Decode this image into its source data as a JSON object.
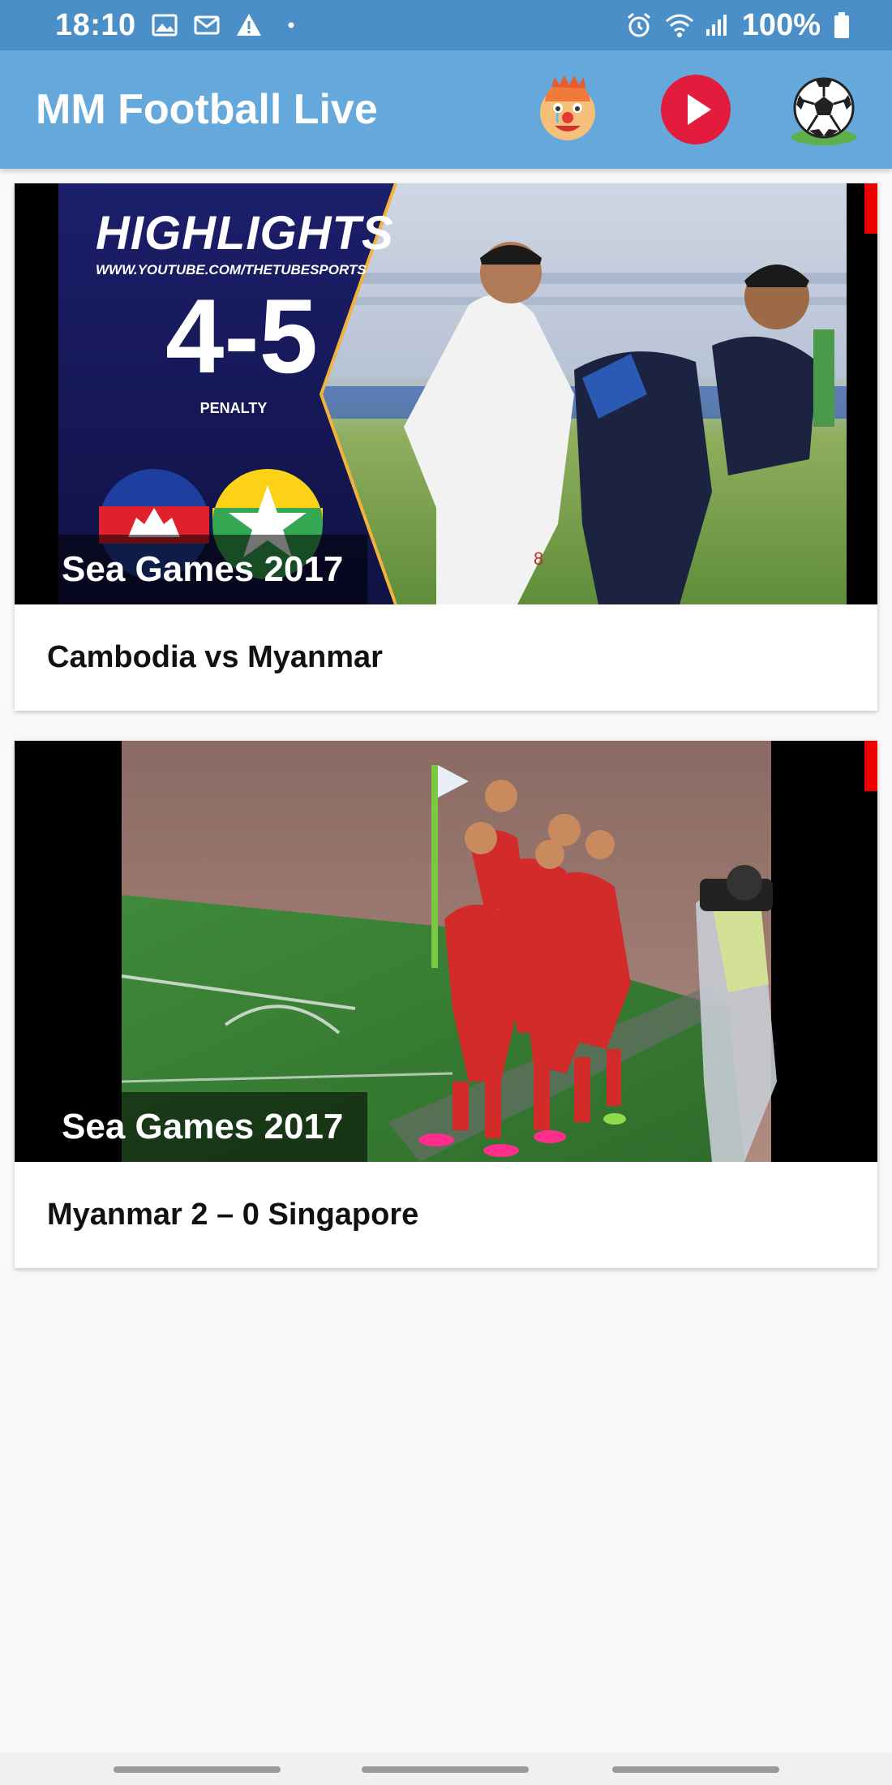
{
  "status_bar": {
    "time": "18:10",
    "battery": "100%",
    "icons_left": [
      "image-icon",
      "mail-icon",
      "warning-icon",
      "dot-icon"
    ],
    "icons_right": [
      "alarm-icon",
      "wifi-icon",
      "signal-icon",
      "battery-icon"
    ]
  },
  "app_bar": {
    "title": "MM Football Live",
    "actions": [
      "clown-icon",
      "youtube-play-icon",
      "soccer-ball-icon"
    ]
  },
  "videos": [
    {
      "overlay": "Sea Games 2017",
      "title": "Cambodia vs Myanmar",
      "thumb_text": {
        "heading": "HIGHLIGHTS",
        "url": "WWW.YOUTUBE.COM/THETUBESPORTS",
        "score": "4-5",
        "sub": "PENALTY"
      }
    },
    {
      "overlay": "Sea Games 2017",
      "title": "Myanmar 2 – 0 Singapore"
    }
  ],
  "colors": {
    "status_bar": "#4a8fc7",
    "app_bar": "#64a8dc",
    "accent_red": "#e00000"
  }
}
